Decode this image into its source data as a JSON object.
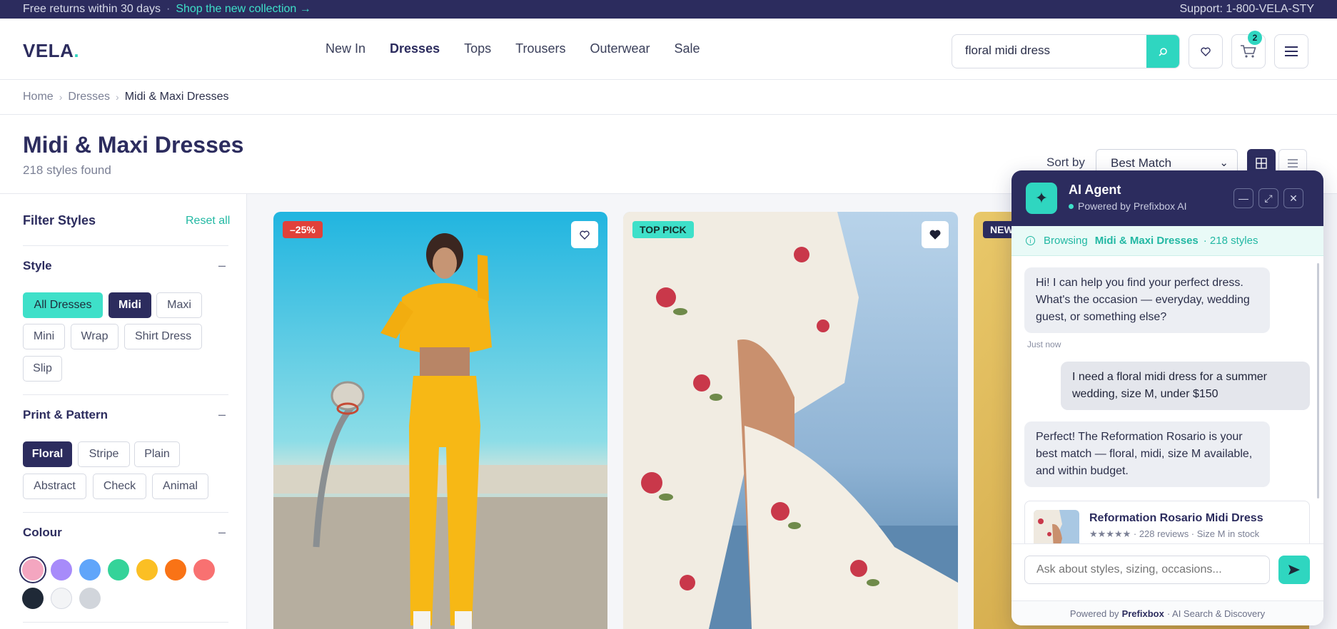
{
  "promo": {
    "message": "Free returns within 30 days",
    "separator": "·",
    "link": "Shop the new collection →",
    "support": "Support: 1-800-VELA-STY"
  },
  "header": {
    "logo": "VELA",
    "logo_dot": ".",
    "nav": [
      "New In",
      "Dresses",
      "Tops",
      "Trousers",
      "Outerwear",
      "Sale"
    ],
    "active_nav": "Dresses",
    "search_value": "floral midi dress",
    "cart_count": "2"
  },
  "breadcrumb": [
    "Home",
    "Dresses",
    "Midi & Maxi Dresses"
  ],
  "title": {
    "heading": "Midi & Maxi Dresses",
    "count": "218 styles found",
    "sort_label": "Sort by",
    "sort_value": "Best Match"
  },
  "filters": {
    "heading": "Filter Styles",
    "reset": "Reset all",
    "style": {
      "title": "Style",
      "toggle": "–",
      "chips": [
        "All Dresses",
        "Midi",
        "Maxi",
        "Mini",
        "Wrap",
        "Shirt Dress",
        "Slip"
      ]
    },
    "print": {
      "title": "Print & Pattern",
      "toggle": "–",
      "chips": [
        "Floral",
        "Stripe",
        "Plain",
        "Abstract",
        "Check",
        "Animal"
      ]
    },
    "colour": {
      "title": "Colour",
      "toggle": "–",
      "swatches": [
        "#f4a6c0",
        "#a78bfa",
        "#60a5fa",
        "#34d399",
        "#fbbf24",
        "#f97316",
        "#f87171",
        "#1f2937",
        "#f3f4f6",
        "#d1d5db"
      ]
    }
  },
  "products": [
    {
      "badge": "–25%",
      "badge_color": "#e0413a"
    },
    {
      "badge": "TOP PICK",
      "badge_color": "#3ee0c9"
    },
    {
      "badge": "NEW",
      "badge_color": "#2c2c5e"
    }
  ],
  "chat": {
    "title": "AI Agent",
    "subtitle": "Powered by Prefixbox AI",
    "context_prefix": "Browsing",
    "context_category": "Midi & Maxi Dresses",
    "context_count": "· 218 styles",
    "messages": [
      {
        "role": "bot",
        "text": "Hi! I can help you find your perfect dress. What's the occasion — everyday, wedding guest, or something else?"
      },
      {
        "role": "user",
        "text": "I need a floral midi dress for a summer wedding, size M, under $150"
      },
      {
        "role": "bot",
        "text": "Perfect! The Reformation Rosario is your best match — floral, midi, size M available, and within budget."
      }
    ],
    "timestamp": "Just now",
    "product": {
      "name": "Reformation Rosario Midi Dress",
      "meta": "★★★★★ · 228 reviews · Size M in stock"
    },
    "input_placeholder": "Ask about styles, sizing, occasions...",
    "footer_prefix": "Powered by",
    "footer_brand": "Prefixbox",
    "footer_suffix": "· AI Search & Discovery"
  }
}
